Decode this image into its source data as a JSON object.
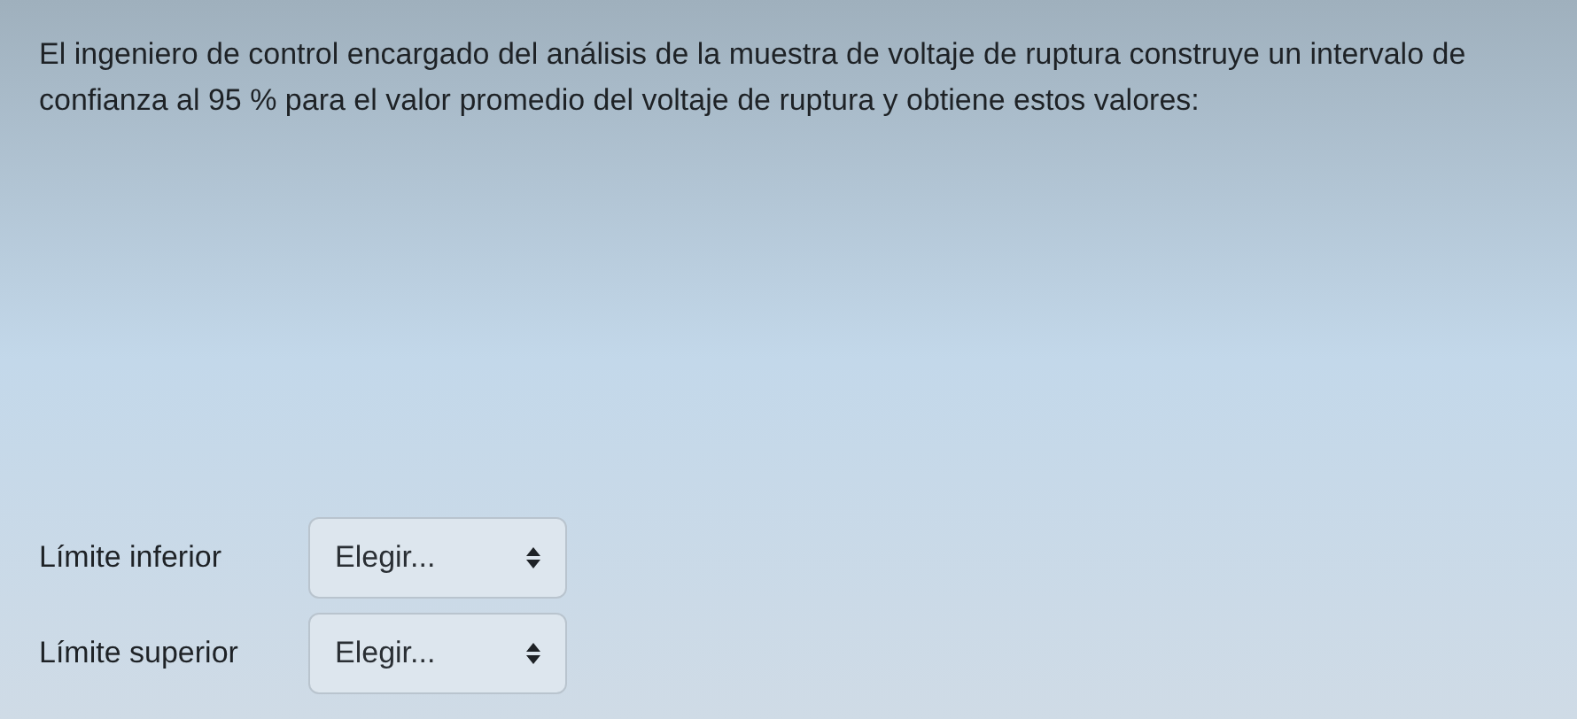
{
  "question": {
    "text": "El ingeniero de control encargado del análisis de la muestra de voltaje de ruptura construye un intervalo de confianza al 95 % para el valor promedio del voltaje de ruptura y obtiene estos valores:"
  },
  "fields": [
    {
      "label": "Límite inferior",
      "value": "Elegir..."
    },
    {
      "label": "Límite superior",
      "value": "Elegir..."
    }
  ]
}
